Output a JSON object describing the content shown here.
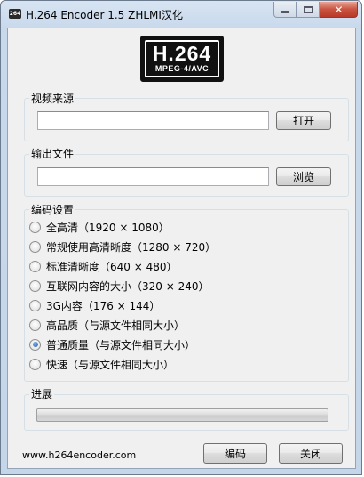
{
  "window": {
    "title": "H.264 Encoder 1.5   ZHLMI汉化",
    "icon": "app-icon"
  },
  "logo": {
    "main": "H.264",
    "sub": "MPEG-4/AVC"
  },
  "source": {
    "label": "视频来源",
    "value": "",
    "open_button": "打开"
  },
  "output": {
    "label": "输出文件",
    "value": "",
    "browse_button": "浏览"
  },
  "settings": {
    "label": "编码设置",
    "options": [
      {
        "label": "全高清（1920 × 1080）",
        "checked": false
      },
      {
        "label": "常规使用高清晰度（1280 × 720）",
        "checked": false
      },
      {
        "label": "标准清晰度（640 × 480）",
        "checked": false
      },
      {
        "label": "互联网内容的大小（320 × 240）",
        "checked": false
      },
      {
        "label": "3G内容（176 × 144）",
        "checked": false
      },
      {
        "label": "高品质（与源文件相同大小）",
        "checked": false
      },
      {
        "label": "普通质量（与源文件相同大小）",
        "checked": true
      },
      {
        "label": "快速（与源文件相同大小）",
        "checked": false
      }
    ]
  },
  "progress": {
    "label": "进展",
    "value": 0
  },
  "footer": {
    "website": "www.h264encoder.com",
    "encode_button": "编码",
    "close_button": "关闭"
  }
}
